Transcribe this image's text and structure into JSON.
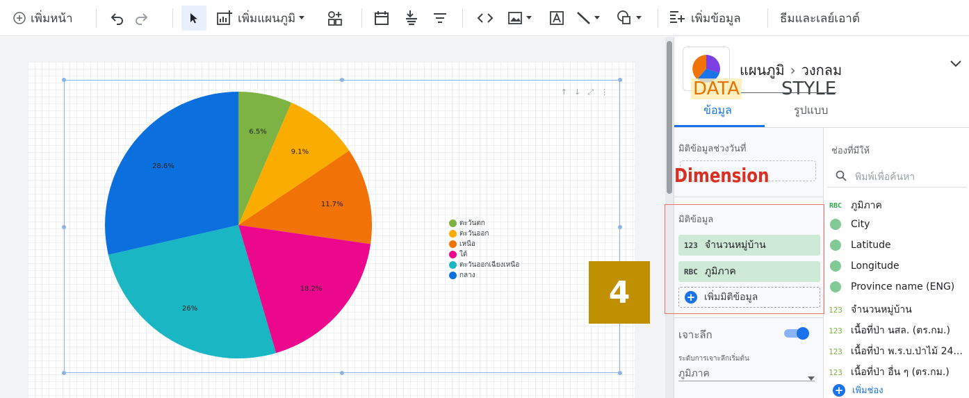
{
  "toolbar": {
    "add_page": "เพิ่มหน้า",
    "add_chart": "เพิ่มแผนภูมิ",
    "add_data": "เพิ่มข้อมูล",
    "theme_layout": "ธีมและเลย์เอาต์",
    "icons": [
      "add-circle-icon",
      "undo-icon",
      "redo-icon",
      "pointer-icon",
      "add-chart-icon",
      "controls-icon",
      "date-range-icon",
      "filter-icon",
      "filter-control-icon",
      "code-icon",
      "image-icon",
      "text-icon",
      "line-icon",
      "shape-icon",
      "add-data-icon"
    ]
  },
  "chart_data": {
    "type": "pie",
    "title": "",
    "series": [
      {
        "name": "ตะวันตก",
        "value": 6.5,
        "label": "6.5%",
        "color": "#7cb342"
      },
      {
        "name": "ตะวันออก",
        "value": 9.1,
        "label": "9.1%",
        "color": "#fbac00"
      },
      {
        "name": "เหนือ",
        "value": 11.7,
        "label": "11.7%",
        "color": "#f17207"
      },
      {
        "name": "ใต้",
        "value": 18.2,
        "label": "18.2%",
        "color": "#ec088d"
      },
      {
        "name": "ตะวันออกเฉียงเหนือ",
        "value": 26,
        "label": "26%",
        "color": "#1ab6c4"
      },
      {
        "name": "กลาง",
        "value": 28.6,
        "label": "28.6%",
        "color": "#0c6fde"
      }
    ],
    "legend_position": "right"
  },
  "panel": {
    "chart_type_parent": "แผนภูมิ",
    "chart_type_child": "วงกลม",
    "overlay_data": "DATA",
    "overlay_style": "STYLE",
    "tab_data": "ข้อมูล",
    "tab_style": "รูปแบบ",
    "date_dimension_label": "มิติข้อมูลช่วงวันที่",
    "overlay_dimension": "Dimension",
    "dimension_label": "มิติข้อมูล",
    "dimension_chips": [
      {
        "type": "123",
        "name": "จำนวนหมู่บ้าน"
      },
      {
        "type": "RBC",
        "name": "ภูมิภาค"
      }
    ],
    "add_dimension": "เพิ่มมิติข้อมูล",
    "drill_down_label": "เจาะลึก",
    "drill_down_enabled": true,
    "drill_level_label": "ระดับการเจาะลึกเริ่มต้น",
    "drill_level_value": "ภูมิภาค",
    "available_fields_label": "ช่องที่มีให้",
    "search_placeholder": "พิมพ์เพื่อค้นหา",
    "fields": [
      {
        "type": "RBC",
        "name": "ภูมิภาค"
      },
      {
        "type": "geo",
        "name": "City"
      },
      {
        "type": "geo",
        "name": "Latitude"
      },
      {
        "type": "geo",
        "name": "Longitude"
      },
      {
        "type": "geo",
        "name": "Province name (ENG)"
      },
      {
        "type": "123",
        "name": "จำนวนหมู่บ้าน"
      },
      {
        "type": "123",
        "name": "เนื้อที่ป่า นสล. (ตร.กม.)"
      },
      {
        "type": "123",
        "name": "เนื้อที่ป่า พ.ร.บ.ป่าไม้ 24..."
      },
      {
        "type": "123",
        "name": "เนื้อที่ป่า อื่น ๆ (ตร.กม.)"
      }
    ],
    "add_field": "เพิ่มช่อง"
  },
  "badge_number": "4"
}
